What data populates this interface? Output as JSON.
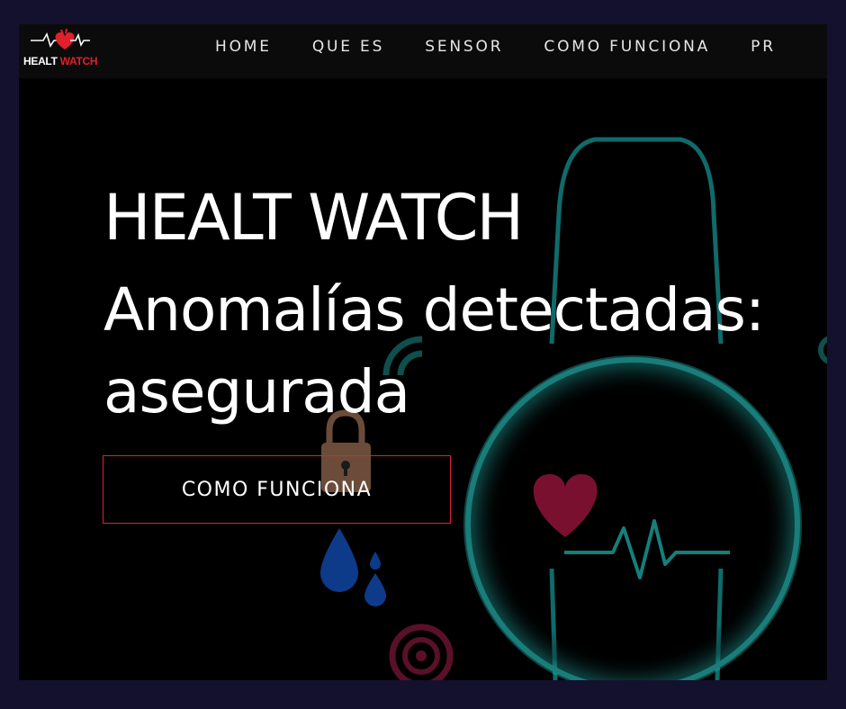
{
  "brand": {
    "logo_word1": "HEALT",
    "logo_word2": "WATCH",
    "logo_icon": "heart-ecg-icon",
    "colors": {
      "accent": "#e0202a",
      "teal": "#1ec9c4",
      "background": "#000000",
      "border": "#14112e"
    }
  },
  "nav": {
    "items": [
      {
        "label": "HOME"
      },
      {
        "label": "QUE ES"
      },
      {
        "label": "SENSOR"
      },
      {
        "label": "COMO FUNCIONA"
      },
      {
        "label": "PR"
      }
    ]
  },
  "hero": {
    "title": "HEALT WATCH",
    "subtitle_line1": "Anomalías detectadas:",
    "subtitle_line2": "asegurada",
    "cta_label": "COMO FUNCIONA"
  },
  "background_icons": [
    "smartwatch-icon",
    "heart-icon",
    "ecg-line-icon",
    "lock-icon",
    "water-drop-icon",
    "wifi-icon",
    "target-icon"
  ]
}
